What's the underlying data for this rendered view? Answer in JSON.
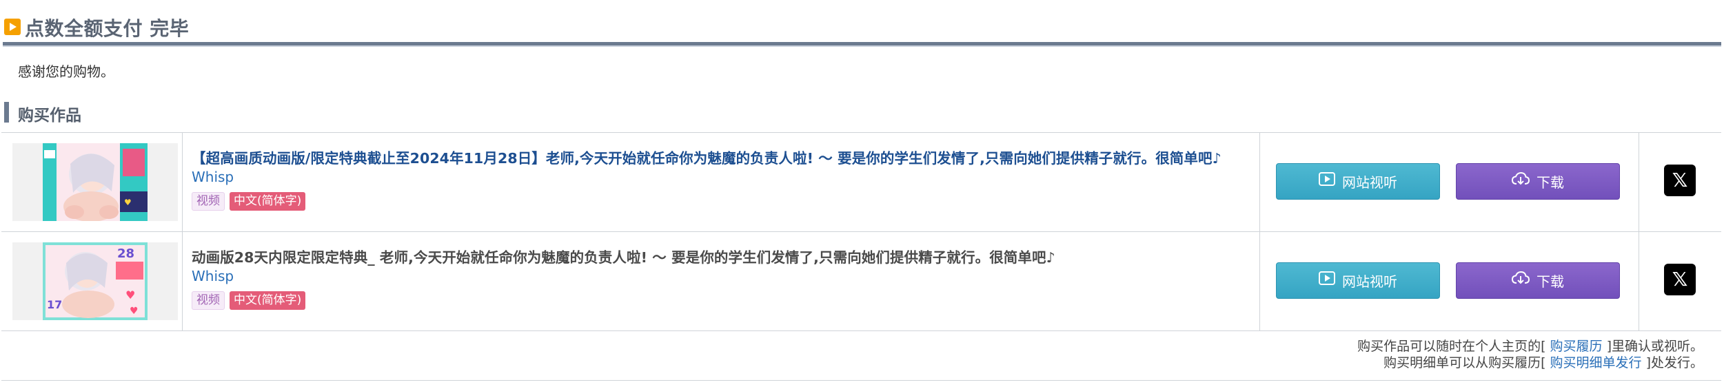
{
  "header": {
    "title": "点数全额支付 完毕"
  },
  "thanks_text": "感谢您的购物。",
  "section_title": "购买作品",
  "works": [
    {
      "title": "【超高画质动画版/限定特典截止至2024年11月28日】老师,今天开始就任命你为魅魔的负责人啦! ～ 要是你的学生们发情了,只需向她们提供精子就行。很简单吧♪",
      "maker": "Whisp",
      "tags": [
        "视频",
        "中文(简体字)"
      ],
      "view_button": "网站视听",
      "download_button": "下载"
    },
    {
      "title": "动画版28天内限定限定特典_ 老师,今天开始就任命你为魅魔的负责人啦! ～ 要是你的学生们发情了,只需向她们提供精子就行。很简单吧♪",
      "maker": "Whisp",
      "tags": [
        "视频",
        "中文(简体字)"
      ],
      "view_button": "网站视听",
      "download_button": "下载"
    }
  ],
  "footer": {
    "line1_pre": "购买作品可以随时在个人主页的[ ",
    "line1_link": "购买履历",
    "line1_post": " ]里确认或视听。",
    "line2_pre": "购买明细单可以从购买履历[ ",
    "line2_link": "购买明细单发行",
    "line2_post": " ]处发行。"
  },
  "icons": {
    "header": "play-square-icon",
    "view": "play-icon",
    "download": "cloud-download-icon",
    "share": "x-logo-icon"
  },
  "colors": {
    "accent_orange": "#f5a000",
    "view_button": "#3fb0cb",
    "download_button": "#7d5ac4",
    "tag_language": "#e45c78",
    "link": "#2a6fb8"
  }
}
